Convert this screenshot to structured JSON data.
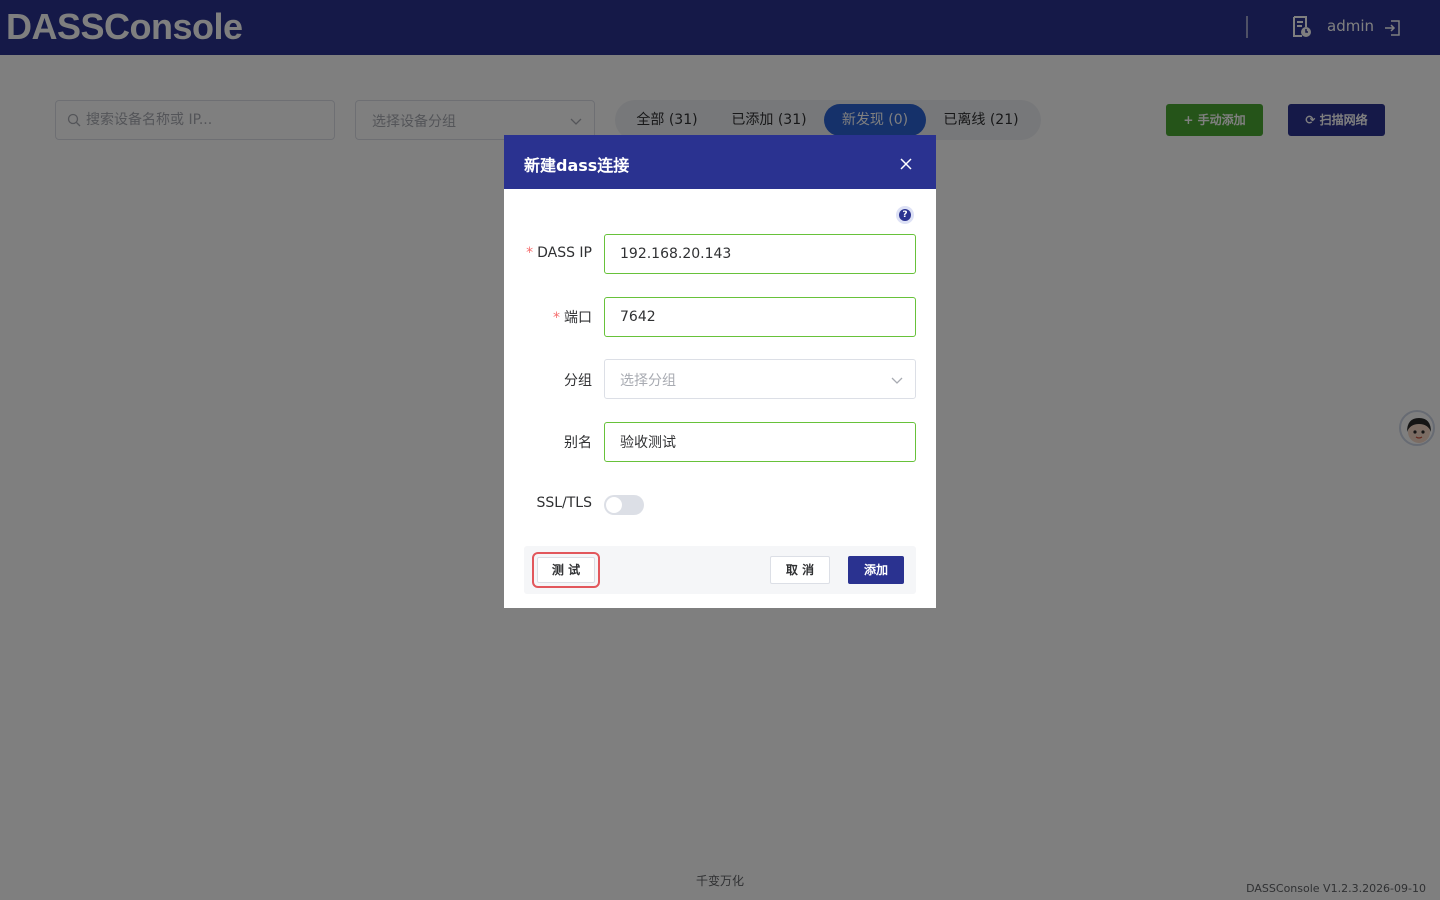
{
  "header": {
    "logo": "DASSConsole",
    "username": "admin",
    "icons": [
      "report-icon",
      "logout-icon"
    ]
  },
  "toolbar": {
    "search_placeholder": "搜索设备名称或 IP...",
    "group_placeholder": "选择设备分组",
    "tabs": [
      {
        "label": "全部 (31)",
        "active": false
      },
      {
        "label": "已添加 (31)",
        "active": false
      },
      {
        "label": "新发现 (0)",
        "active": true
      },
      {
        "label": "已离线 (21)",
        "active": false
      }
    ],
    "add_manual_label": "手动添加",
    "scan_label": "扫描网络"
  },
  "footer": {
    "center_text": "千变万化",
    "version": "DASSConsole V1.2.3.2026-09-10"
  },
  "dialog": {
    "title": "新建dass连接",
    "fields": {
      "ip": {
        "label": "DASS IP",
        "required": true,
        "value": "192.168.20.143"
      },
      "port": {
        "label": "端口",
        "required": true,
        "value": "7642"
      },
      "group": {
        "label": "分组",
        "required": false,
        "placeholder": "选择分组"
      },
      "alias": {
        "label": "别名",
        "required": false,
        "value": "验收测试"
      },
      "ssl": {
        "label": "SSL/TLS",
        "enabled": false
      }
    },
    "buttons": {
      "test": "测 试",
      "cancel": "取 消",
      "add": "添加"
    }
  },
  "colors": {
    "header_bg": "#2a3290",
    "accent_blue": "#2a62d4",
    "add_green": "#4aa833",
    "valid_border": "#67c23a",
    "required_star": "#f56c6c",
    "highlight": "#e2575c"
  }
}
